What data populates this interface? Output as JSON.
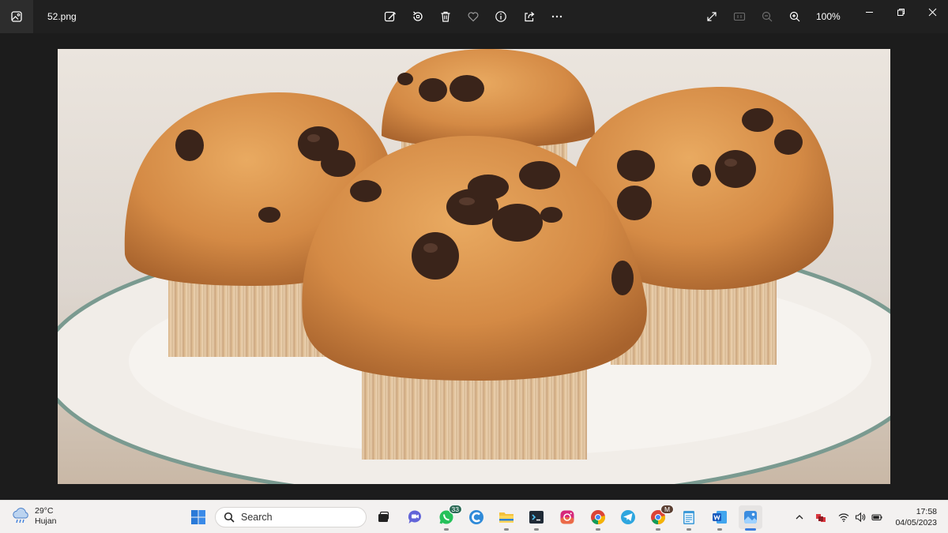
{
  "titlebar": {
    "file_name": "52.png",
    "zoom_level": "100%",
    "toolbar_icons": [
      "edit-image-icon",
      "rotate-icon",
      "delete-icon",
      "favorite-icon",
      "info-icon",
      "share-icon",
      "more-icon"
    ],
    "view_icons": [
      "fullscreen-icon",
      "actual-size-icon",
      "zoom-out-icon",
      "zoom-in-icon"
    ]
  },
  "viewer": {
    "image_content": "muffins-photo"
  },
  "taskbar": {
    "weather": {
      "temperature": "29°C",
      "condition": "Hujan"
    },
    "search": {
      "placeholder": "Search"
    },
    "whatsapp_badge": "33",
    "chrome_profile_badge": "M",
    "clock": {
      "time": "17:58",
      "date": "04/05/2023"
    },
    "accent": "#3b7ddd"
  }
}
